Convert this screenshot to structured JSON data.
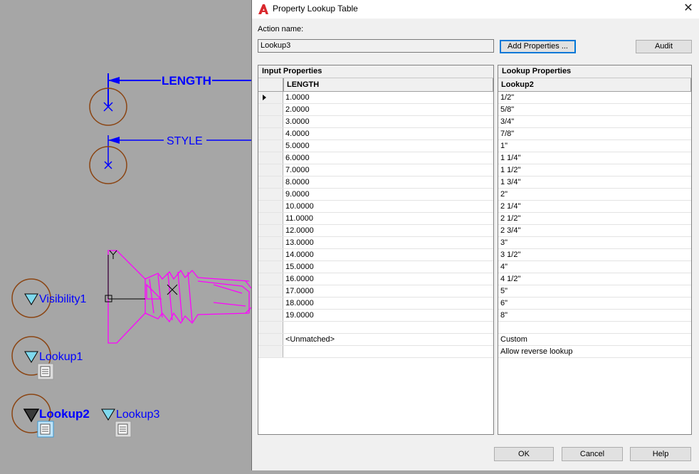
{
  "canvas": {
    "params": [
      "LENGTH",
      "STYLE"
    ],
    "labels": [
      "Visibility1",
      "Lookup1",
      "Lookup2",
      "Lookup3"
    ],
    "ucs_y": "Y",
    "colors": {
      "background": "#a6a6a6",
      "blue": "#0000ff",
      "magenta": "#ff00ff",
      "brown": "#8b4513",
      "cyan": "#7fd9ee"
    }
  },
  "dialog": {
    "title": "Property Lookup Table",
    "app_icon": "autocad-logo-icon",
    "close": "✕",
    "action_name_label": "Action name:",
    "action_name_value": "Lookup3",
    "add_properties": "Add Properties ...",
    "audit": "Audit",
    "input_header": "Input Properties",
    "input_column": "LENGTH",
    "lookup_header": "Lookup Properties",
    "lookup_column": "Lookup2",
    "rows": [
      {
        "input": "1.0000",
        "lookup": "1/2\""
      },
      {
        "input": "2.0000",
        "lookup": "5/8\""
      },
      {
        "input": "3.0000",
        "lookup": "3/4\""
      },
      {
        "input": "4.0000",
        "lookup": "7/8\""
      },
      {
        "input": "5.0000",
        "lookup": "1\""
      },
      {
        "input": "6.0000",
        "lookup": "1 1/4\""
      },
      {
        "input": "7.0000",
        "lookup": "1 1/2\""
      },
      {
        "input": "8.0000",
        "lookup": "1 3/4\""
      },
      {
        "input": "9.0000",
        "lookup": "2\""
      },
      {
        "input": "10.0000",
        "lookup": "2 1/4\""
      },
      {
        "input": "11.0000",
        "lookup": "2 1/2\""
      },
      {
        "input": "12.0000",
        "lookup": "2 3/4\""
      },
      {
        "input": "13.0000",
        "lookup": "3\""
      },
      {
        "input": "14.0000",
        "lookup": "3 1/2\""
      },
      {
        "input": "15.0000",
        "lookup": "4\""
      },
      {
        "input": "16.0000",
        "lookup": "4 1/2\""
      },
      {
        "input": "17.0000",
        "lookup": "5\""
      },
      {
        "input": "18.0000",
        "lookup": "6\""
      },
      {
        "input": "19.0000",
        "lookup": "8\""
      },
      {
        "input": "",
        "lookup": ""
      },
      {
        "input": "<Unmatched>",
        "lookup": "Custom"
      },
      {
        "input": "",
        "lookup": "Allow reverse lookup"
      }
    ],
    "ok": "OK",
    "cancel": "Cancel",
    "help": "Help"
  }
}
